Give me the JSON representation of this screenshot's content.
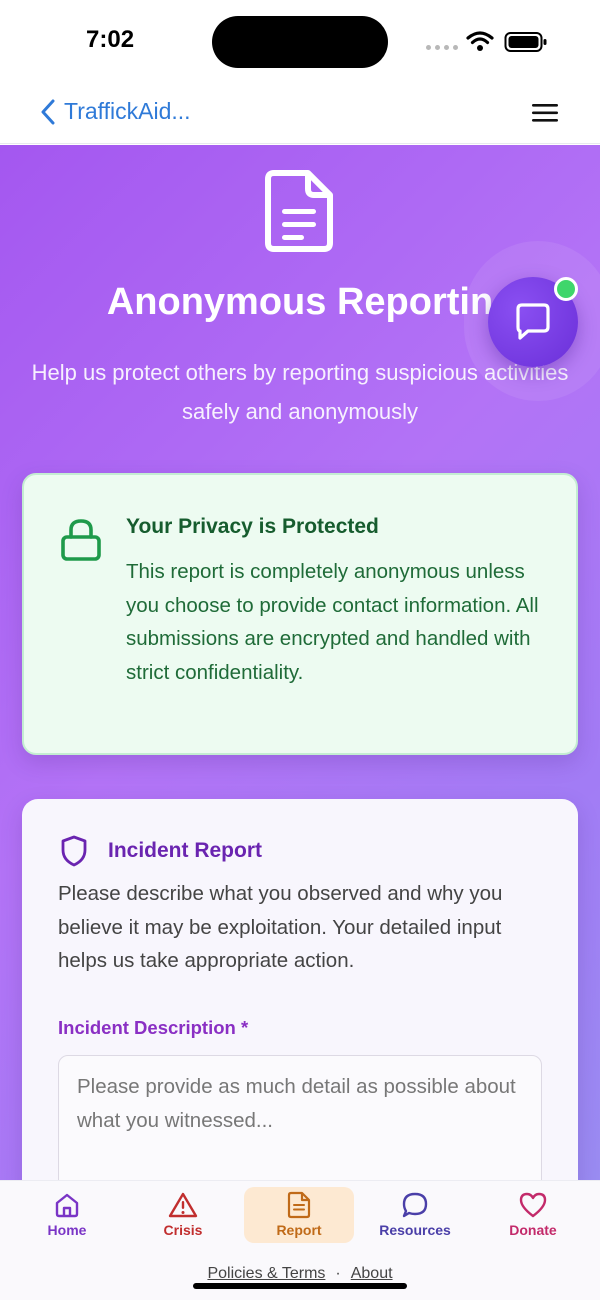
{
  "status": {
    "time": "7:02"
  },
  "nav": {
    "back_label": "TraffickAid..."
  },
  "hero": {
    "title": "Anonymous Reportin",
    "subtitle": "Help us protect others by reporting suspicious activities safely and anonymously"
  },
  "privacy": {
    "title": "Your Privacy is Protected",
    "text": "This report is completely anonymous unless you choose to provide contact information. All submissions are encrypted and handled with strict confidentiality."
  },
  "incident": {
    "title": "Incident Report",
    "description": "Please describe what you observed and why you believe it may be exploitation. Your detailed input helps us take appropriate action.",
    "field_label": "Incident Description *",
    "placeholder": "Please provide as much detail as possible about what you witnessed...",
    "value": ""
  },
  "tabs": [
    {
      "label": "Home",
      "icon": "home-icon",
      "color": "#7a35c6"
    },
    {
      "label": "Crisis",
      "icon": "warning-icon",
      "color": "#c12e2e"
    },
    {
      "label": "Report",
      "icon": "document-icon",
      "color": "#c06a18",
      "active": true
    },
    {
      "label": "Resources",
      "icon": "chat-bubble-icon",
      "color": "#4a3fa8"
    },
    {
      "label": "Donate",
      "icon": "heart-icon",
      "color": "#c32a6a"
    }
  ],
  "footer": {
    "policies": "Policies & Terms",
    "separator": "·",
    "about": "About"
  },
  "colors": {
    "accent": "#a457f0",
    "privacy_green": "#165c2e",
    "incident_purple": "#6a24b0"
  }
}
